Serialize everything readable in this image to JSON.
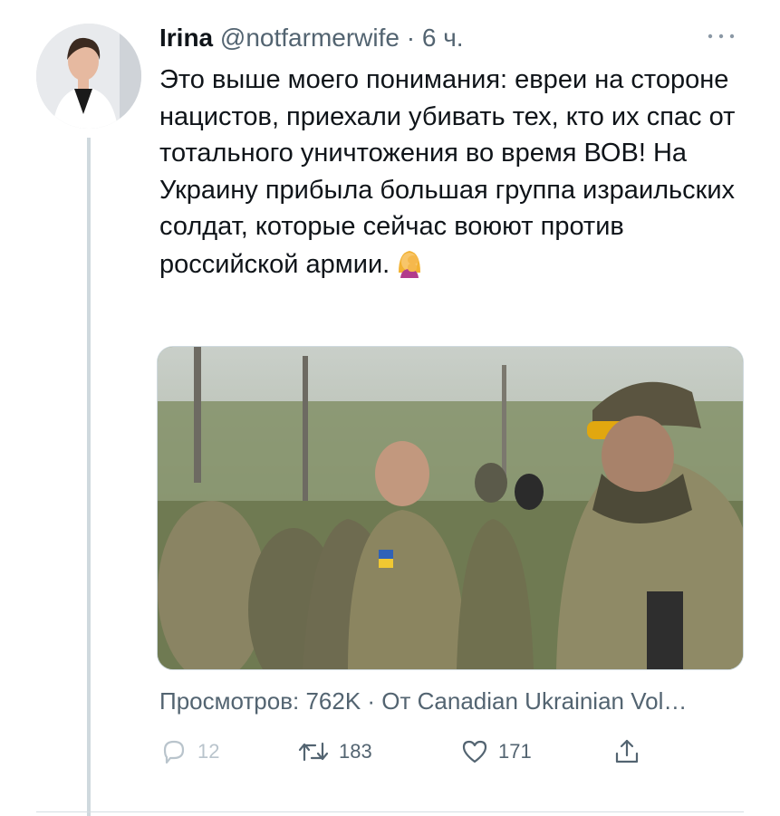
{
  "tweet": {
    "author_name": "Irina",
    "author_handle": "@notfarmerwife",
    "separator": "·",
    "time": "6 ч.",
    "more_icon": "ellipsis-icon",
    "text": "Это выше моего понимания: евреи на стороне нацистов, приехали убивать тех, кто их спас от тотального уничтожения во время ВОВ! На Украину прибыла большая группа израильских солдат, которые сейчас воюют против российской армии.",
    "emoji": "woman-facepalming-emoji",
    "views_line": "Просмотров: 762K · От Canadian Ukrainian Vol…",
    "actions": {
      "reply_count": "12",
      "retweet_count": "183",
      "like_count": "171"
    }
  },
  "colors": {
    "text_primary": "#0f1419",
    "text_secondary": "#536471",
    "border": "#cfd9de"
  }
}
